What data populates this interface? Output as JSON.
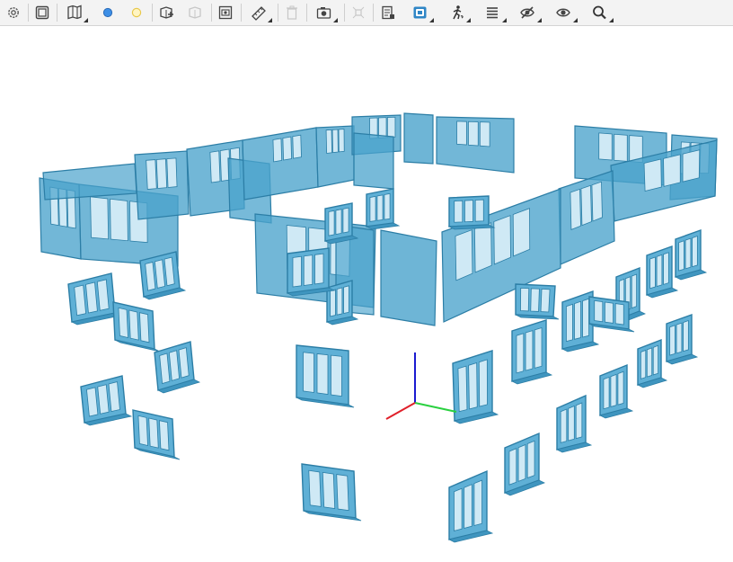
{
  "toolbar": {
    "buttons": [
      {
        "icon": "settings-icon",
        "dropdown": false,
        "enabled": true
      },
      {
        "icon": "frame-icon",
        "dropdown": false,
        "enabled": true
      },
      {
        "icon": "map-icon",
        "dropdown": true,
        "enabled": true
      },
      {
        "icon": "blue-circle-icon",
        "dropdown": false,
        "enabled": true
      },
      {
        "icon": "yellow-circle-icon",
        "dropdown": false,
        "enabled": true
      },
      {
        "icon": "add-box-icon",
        "dropdown": false,
        "enabled": true
      },
      {
        "icon": "copy-box-icon",
        "dropdown": false,
        "enabled": false
      },
      {
        "icon": "box-camera-icon",
        "dropdown": false,
        "enabled": true
      },
      {
        "icon": "ruler-icon",
        "dropdown": true,
        "enabled": true
      },
      {
        "icon": "trash-icon",
        "dropdown": false,
        "enabled": false
      },
      {
        "icon": "camera-icon",
        "dropdown": true,
        "enabled": true
      },
      {
        "icon": "explode-icon",
        "dropdown": false,
        "enabled": false
      },
      {
        "icon": "properties-icon",
        "dropdown": false,
        "enabled": true
      },
      {
        "icon": "section-icon",
        "dropdown": true,
        "enabled": true
      },
      {
        "icon": "walk-icon",
        "dropdown": true,
        "enabled": true
      },
      {
        "icon": "list-icon",
        "dropdown": true,
        "enabled": true
      },
      {
        "icon": "hide-icon",
        "dropdown": true,
        "enabled": true
      },
      {
        "icon": "eye-icon",
        "dropdown": true,
        "enabled": true
      },
      {
        "icon": "search-icon",
        "dropdown": true,
        "enabled": true
      }
    ]
  },
  "viewport": {
    "model_color": "#4aa3cc",
    "glass_color": "#cfe9f5",
    "axis_x_color": "#e0202a",
    "axis_y_color": "#2ad040",
    "axis_z_color": "#1a1ad0"
  }
}
